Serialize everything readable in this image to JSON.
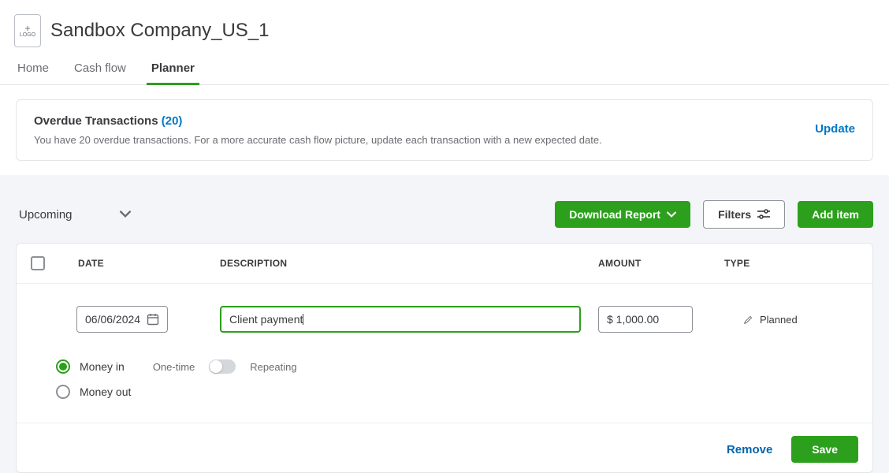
{
  "header": {
    "logo_top": "+",
    "logo_bottom": "LOGO",
    "company_name": "Sandbox Company_US_1"
  },
  "tabs": [
    {
      "label": "Home",
      "active": false
    },
    {
      "label": "Cash flow",
      "active": false
    },
    {
      "label": "Planner",
      "active": true
    }
  ],
  "notice": {
    "title": "Overdue Transactions",
    "count": "(20)",
    "subtitle": "You have 20 overdue transactions. For a more accurate cash flow picture, update each transaction with a new expected date.",
    "action": "Update"
  },
  "toolbar": {
    "view_dropdown": "Upcoming",
    "download_label": "Download Report",
    "filters_label": "Filters",
    "add_label": "Add item"
  },
  "table": {
    "headers": {
      "date": "DATE",
      "description": "DESCRIPTION",
      "amount": "AMOUNT",
      "type": "TYPE"
    },
    "row": {
      "date": "06/06/2024",
      "description": "Client payment",
      "amount": "$ 1,000.00",
      "type": "Planned"
    }
  },
  "options": {
    "money_in": "Money in",
    "money_out": "Money out",
    "one_time": "One-time",
    "repeating": "Repeating"
  },
  "footer": {
    "remove": "Remove",
    "save": "Save"
  }
}
